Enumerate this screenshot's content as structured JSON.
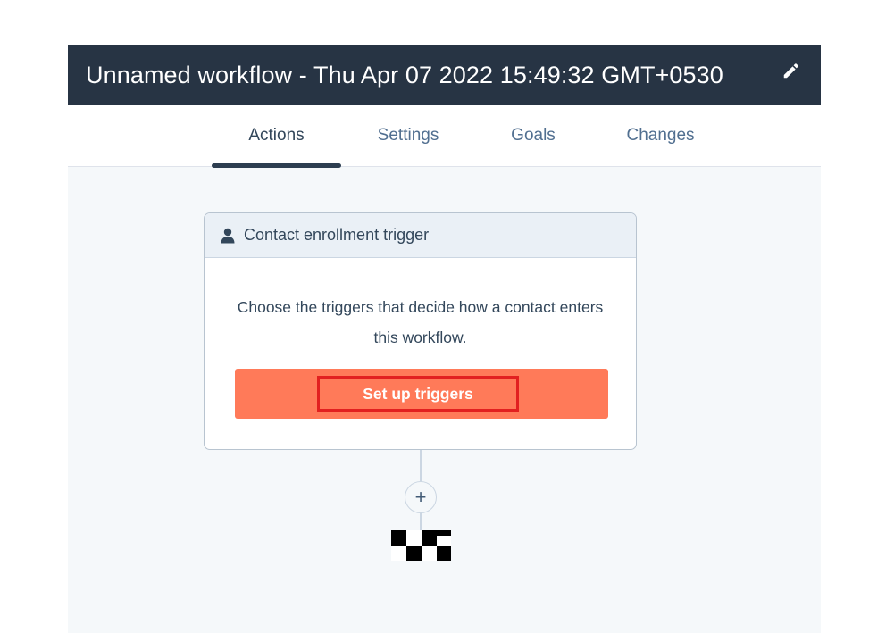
{
  "header": {
    "title": "Unnamed workflow - Thu Apr 07 2022 15:49:32 GMT+0530",
    "edit_icon": "pencil-icon"
  },
  "tabs": [
    {
      "label": "Actions",
      "active": true
    },
    {
      "label": "Settings",
      "active": false
    },
    {
      "label": "Goals",
      "active": false
    },
    {
      "label": "Changes",
      "active": false
    }
  ],
  "trigger_card": {
    "header_icon": "person-icon",
    "header_label": "Contact enrollment trigger",
    "description": "Choose the triggers that decide how a contact enters this workflow.",
    "button_label": "Set up triggers",
    "button_color": "#ff7a59",
    "highlight_color": "#e22020"
  },
  "add_action": {
    "label": "+",
    "icon": "plus-icon"
  },
  "end_marker": {
    "icon": "checkered-flag-icon"
  },
  "colors": {
    "header_bg": "#273444",
    "canvas_bg": "#f5f8fa",
    "text": "#33475b"
  }
}
